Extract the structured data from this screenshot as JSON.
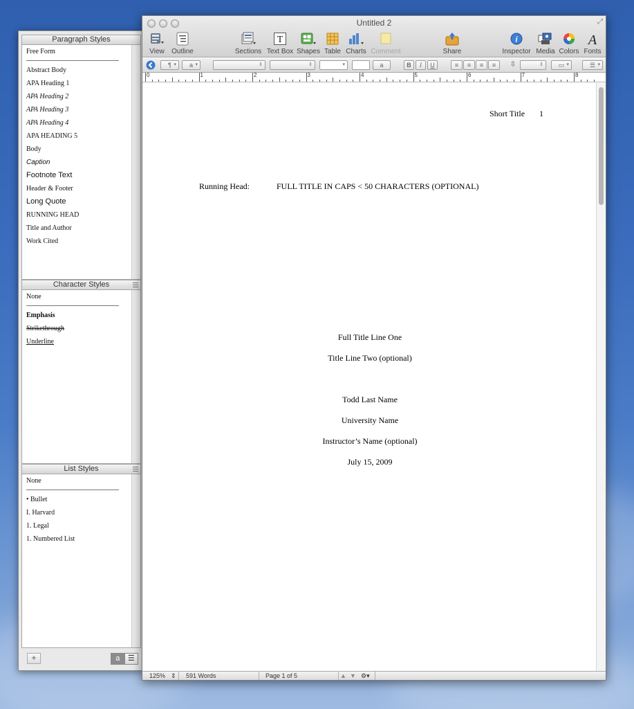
{
  "window": {
    "title": "Untitled 2"
  },
  "toolbar": {
    "items": [
      {
        "label": "View",
        "icon": "view-icon"
      },
      {
        "label": "Outline",
        "icon": "outline-icon"
      },
      {
        "label": "Sections",
        "icon": "sections-icon"
      },
      {
        "label": "Text Box",
        "icon": "text-box-icon"
      },
      {
        "label": "Shapes",
        "icon": "shapes-icon"
      },
      {
        "label": "Table",
        "icon": "table-icon"
      },
      {
        "label": "Charts",
        "icon": "charts-icon"
      },
      {
        "label": "Comment",
        "icon": "comment-icon",
        "disabled": true
      },
      {
        "label": "Share",
        "icon": "share-icon"
      },
      {
        "label": "Inspector",
        "icon": "inspector-icon"
      },
      {
        "label": "Media",
        "icon": "media-icon"
      },
      {
        "label": "Colors",
        "icon": "colors-icon"
      },
      {
        "label": "Fonts",
        "icon": "fonts-icon"
      }
    ]
  },
  "formatbar": {
    "char_style_glyph": "a",
    "bold": "B",
    "italic": "I",
    "underline": "U"
  },
  "ruler": {
    "numbers": [
      "0",
      "1",
      "2",
      "3",
      "4",
      "5",
      "6",
      "7",
      "8"
    ]
  },
  "document": {
    "header_short_title": "Short Title",
    "header_page_number": "1",
    "running_head_label": "Running Head:",
    "running_head_text": "FULL TITLE IN CAPS < 50 CHARACTERS (OPTIONAL)",
    "title_line_one": "Full Title Line One",
    "title_line_two": "Title Line Two (optional)",
    "author": "Todd Last Name",
    "university": "University Name",
    "instructor": "Instructor’s Name (optional)",
    "date": "July 15, 2009"
  },
  "status": {
    "zoom": "125%",
    "word_count": "591 Words",
    "page": "Page 1 of 5"
  },
  "drawer": {
    "paragraph_styles": {
      "title": "Paragraph Styles",
      "items": [
        "Free Form",
        "Abstract Body",
        "APA Heading 1",
        "APA Heading 2",
        "APA Heading 3",
        "APA Heading 4",
        "APA HEADING 5",
        "Body",
        "Caption",
        "Footnote Text",
        "Header & Footer",
        "Long Quote",
        "RUNNING HEAD",
        "Title and Author",
        "Work Cited"
      ]
    },
    "character_styles": {
      "title": "Character Styles",
      "items": [
        "None",
        "Emphasis",
        "Strikethrough",
        "Underline"
      ]
    },
    "list_styles": {
      "title": "List Styles",
      "items": [
        "None",
        "• Bullet",
        "I. Harvard",
        "1. Legal",
        "1. Numbered List"
      ]
    },
    "footer": {
      "add_label": "+",
      "char_toggle": "a",
      "list_toggle": "☰"
    }
  }
}
